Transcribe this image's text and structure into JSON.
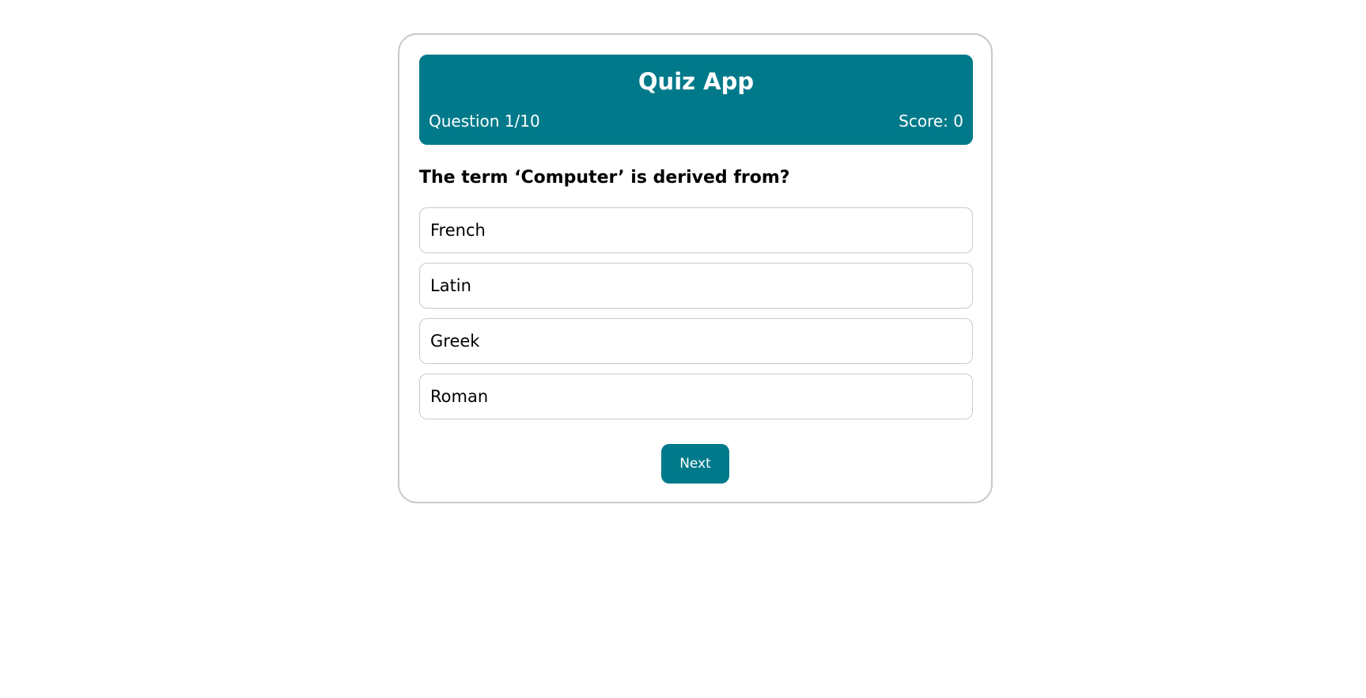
{
  "header": {
    "title": "Quiz App",
    "question_counter": "Question 1/10",
    "score": "Score: 0"
  },
  "question": {
    "text": "The term ‘Computer’ is derived from?",
    "options": [
      "French",
      "Latin",
      "Greek",
      "Roman"
    ]
  },
  "actions": {
    "next_label": "Next"
  },
  "colors": {
    "accent": "#007a8a",
    "border": "#c9c9c9"
  }
}
